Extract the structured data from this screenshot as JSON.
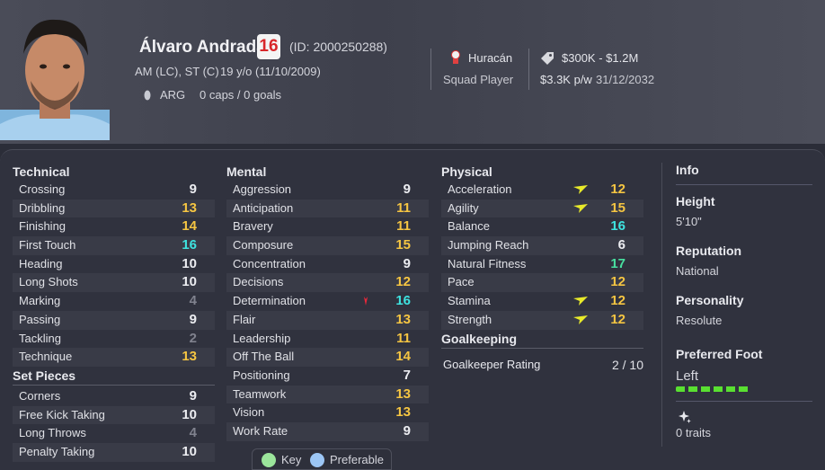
{
  "player": {
    "name": "Álvaro Andrada",
    "ability": "16",
    "id_text": "(ID: 2000250288)",
    "positions": "AM (LC), ST (C)",
    "age": "19 y/o (11/10/2009)",
    "nationality": "ARG",
    "caps": "0 caps / 0 goals"
  },
  "club": {
    "name": "Huracán",
    "status": "Squad Player",
    "value": "$300K - $1.2M",
    "wage": "$3.3K p/w",
    "expiry": "31/12/2032"
  },
  "technical": {
    "title": "Technical",
    "rows": [
      {
        "label": "Crossing",
        "value": "9",
        "color": "white"
      },
      {
        "label": "Dribbling",
        "value": "13",
        "color": "yellow"
      },
      {
        "label": "Finishing",
        "value": "14",
        "color": "yellow"
      },
      {
        "label": "First Touch",
        "value": "16",
        "color": "cyan"
      },
      {
        "label": "Heading",
        "value": "10",
        "color": "white"
      },
      {
        "label": "Long Shots",
        "value": "10",
        "color": "white"
      },
      {
        "label": "Marking",
        "value": "4",
        "color": "grey"
      },
      {
        "label": "Passing",
        "value": "9",
        "color": "white"
      },
      {
        "label": "Tackling",
        "value": "2",
        "color": "grey"
      },
      {
        "label": "Technique",
        "value": "13",
        "color": "yellow"
      }
    ]
  },
  "set_pieces": {
    "title": "Set Pieces",
    "rows": [
      {
        "label": "Corners",
        "value": "9",
        "color": "white"
      },
      {
        "label": "Free Kick Taking",
        "value": "10",
        "color": "white"
      },
      {
        "label": "Long Throws",
        "value": "4",
        "color": "grey"
      },
      {
        "label": "Penalty Taking",
        "value": "10",
        "color": "white"
      }
    ]
  },
  "mental": {
    "title": "Mental",
    "rows": [
      {
        "label": "Aggression",
        "value": "9",
        "color": "white"
      },
      {
        "label": "Anticipation",
        "value": "11",
        "color": "yellow"
      },
      {
        "label": "Bravery",
        "value": "11",
        "color": "yellow"
      },
      {
        "label": "Composure",
        "value": "15",
        "color": "yellow"
      },
      {
        "label": "Concentration",
        "value": "9",
        "color": "white"
      },
      {
        "label": "Decisions",
        "value": "12",
        "color": "yellow"
      },
      {
        "label": "Determination",
        "value": "16",
        "color": "cyan",
        "flag": "down-red"
      },
      {
        "label": "Flair",
        "value": "13",
        "color": "yellow"
      },
      {
        "label": "Leadership",
        "value": "11",
        "color": "yellow"
      },
      {
        "label": "Off The Ball",
        "value": "14",
        "color": "yellow"
      },
      {
        "label": "Positioning",
        "value": "7",
        "color": "white"
      },
      {
        "label": "Teamwork",
        "value": "13",
        "color": "yellow"
      },
      {
        "label": "Vision",
        "value": "13",
        "color": "yellow"
      },
      {
        "label": "Work Rate",
        "value": "9",
        "color": "white"
      }
    ]
  },
  "physical": {
    "title": "Physical",
    "rows": [
      {
        "label": "Acceleration",
        "value": "12",
        "color": "yellow",
        "flag": "up-yellow"
      },
      {
        "label": "Agility",
        "value": "15",
        "color": "yellow",
        "flag": "up-yellow"
      },
      {
        "label": "Balance",
        "value": "16",
        "color": "cyan"
      },
      {
        "label": "Jumping Reach",
        "value": "6",
        "color": "white"
      },
      {
        "label": "Natural Fitness",
        "value": "17",
        "color": "green"
      },
      {
        "label": "Pace",
        "value": "12",
        "color": "yellow"
      },
      {
        "label": "Stamina",
        "value": "12",
        "color": "yellow",
        "flag": "up-yellow"
      },
      {
        "label": "Strength",
        "value": "12",
        "color": "yellow",
        "flag": "up-yellow"
      }
    ]
  },
  "goalkeeping": {
    "title": "Goalkeeping",
    "rating_label": "Goalkeeper Rating",
    "rating_value": "2 / 10"
  },
  "legend": {
    "key_label": "Key",
    "preferable_label": "Preferable",
    "key_color": "#9be59b",
    "preferable_color": "#9cc6f5"
  },
  "info": {
    "title": "Info",
    "height_label": "Height",
    "height_value": "5'10\"",
    "reputation_label": "Reputation",
    "reputation_value": "National",
    "personality_label": "Personality",
    "personality_value": "Resolute",
    "foot_label": "Preferred Foot",
    "foot_value": "Left",
    "traits_value": "0 traits"
  }
}
